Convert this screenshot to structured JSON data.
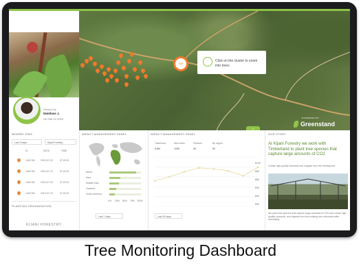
{
  "colors": {
    "accent": "#8fc448",
    "pin": "#f07a2a",
    "story_title": "#5a8a2e"
  },
  "planter": {
    "planted_by_label": "Planted by",
    "name": "Makibwe J.",
    "date": "On Feb 12 2019"
  },
  "map": {
    "cluster_count": "416",
    "tooltip": "Click on the cluster to zoom into trees",
    "brand_powered": "POWERED BY",
    "brand_name": "Greenstand",
    "collapse_icon": "chevron-down-icon"
  },
  "nearby_pins": {
    "title": "NEARBY PINS",
    "filter_left": "Last 3 days",
    "filter_right": "Kijani Forestry",
    "headers": [
      "ID",
      "DATE",
      "TIME"
    ],
    "rows": [
      {
        "id": "1491784",
        "date": "2019-07-22",
        "time": "07:20:21"
      },
      {
        "id": "1491784",
        "date": "2019-07-22",
        "time": "07:20:21"
      },
      {
        "id": "1491784",
        "date": "2019-07-22",
        "time": "07:20:21"
      },
      {
        "id": "1491784",
        "date": "2019-07-22",
        "time": "07:20:21"
      }
    ],
    "org_title": "PLANTING ORGANISATION",
    "org_name": "KIJANI FORESTRY"
  },
  "impact_map": {
    "title": "IMPACT MANAGEMENT PANEL",
    "regions": [
      {
        "label": "Africa",
        "value": 0.85
      },
      {
        "label": "Asia",
        "value": 0.35
      },
      {
        "label": "Middle East",
        "value": 0.3
      },
      {
        "label": "Oceania",
        "value": 0.22
      },
      {
        "label": "South America",
        "value": 0.18
      }
    ],
    "axis_ticks": [
      "0%",
      "25%",
      "50%",
      "75%",
      "100%"
    ],
    "footer_select": "Last 7 days"
  },
  "impact_chart": {
    "title": "IMPACT MANAGEMENT PANEL",
    "stats": [
      {
        "label": "Total trees",
        "value": "6.5M"
      },
      {
        "label": "New trees",
        "value": "100K"
      },
      {
        "label": "Planters",
        "value": "30"
      },
      {
        "label": "By region",
        "value": "50"
      }
    ],
    "y_ticks": [
      "$10K",
      "$8K",
      "$6K",
      "$4K",
      "$2K",
      "$0K"
    ],
    "footer_select": "Last 30 days"
  },
  "chart_data": {
    "type": "line",
    "x": [
      1,
      2,
      3,
      4,
      5,
      6,
      7,
      8
    ],
    "series": [
      {
        "values": [
          5.2,
          6.0,
          7.0,
          7.8,
          7.6,
          7.2,
          6.2,
          7.9
        ]
      }
    ],
    "ylim": [
      0,
      10
    ]
  },
  "story": {
    "title_label": "OUR STORY",
    "heading": "At Kijani Forestry we work with Timberland to plant tree species that capture large amounts of CO2",
    "sub": "Create high-quality channels and migrate from the existing tree",
    "body": "We plant tree species that capture large amounts of CO2 and create high-quality channels, and migrate from the existing tree structures after harvesting."
  },
  "caption": "Tree Monitoring Dashboard"
}
